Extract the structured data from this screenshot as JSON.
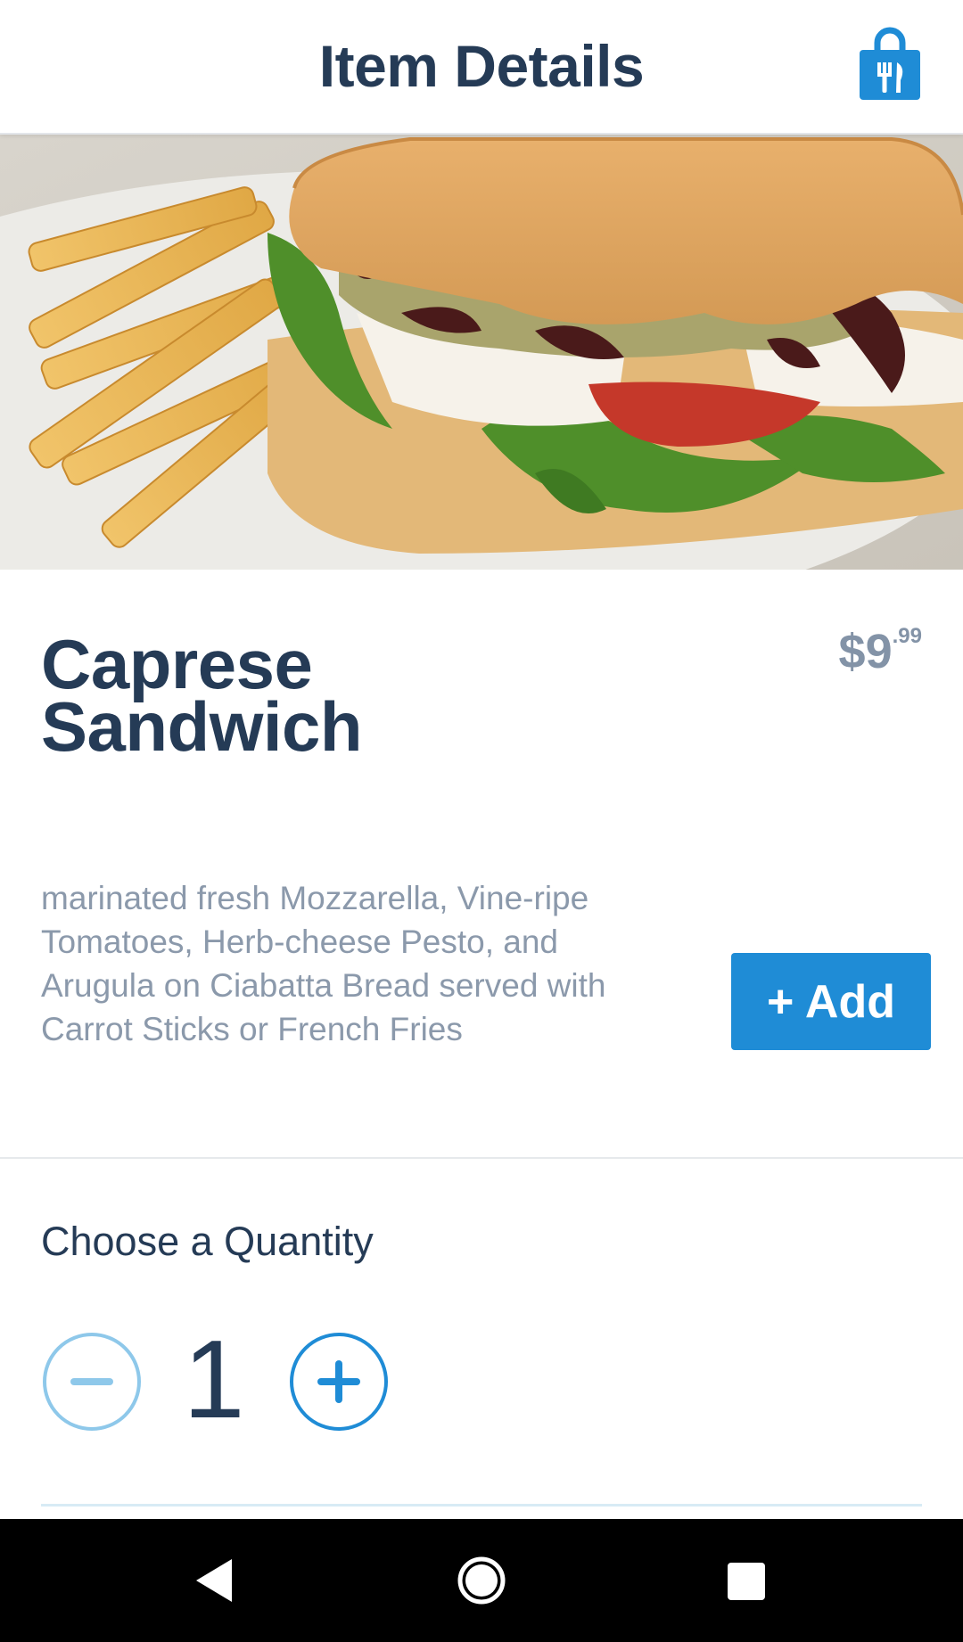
{
  "header": {
    "title": "Item Details",
    "bag_icon": "shopping-bag-fork-knife-icon",
    "accent_color": "#1f8cd6"
  },
  "hero": {
    "image_alt": "Caprese Sandwich with french fries"
  },
  "item": {
    "name_line1": "Caprese",
    "name_line2": "Sandwich",
    "price_dollars": "$9",
    "price_cents": ".99",
    "description": "marinated fresh Mozzarella, Vine-ripe Tomatoes, Herb-cheese Pesto, and Arugula on Ciabatta Bread served with Carrot Sticks or French Fries",
    "add_label": "+ Add"
  },
  "quantity": {
    "label": "Choose a Quantity",
    "value": "1",
    "minus_icon": "minus-icon",
    "plus_icon": "plus-icon"
  },
  "navbar": {
    "back_icon": "back-triangle-icon",
    "home_icon": "home-circle-icon",
    "recent_icon": "recent-apps-square-icon"
  }
}
